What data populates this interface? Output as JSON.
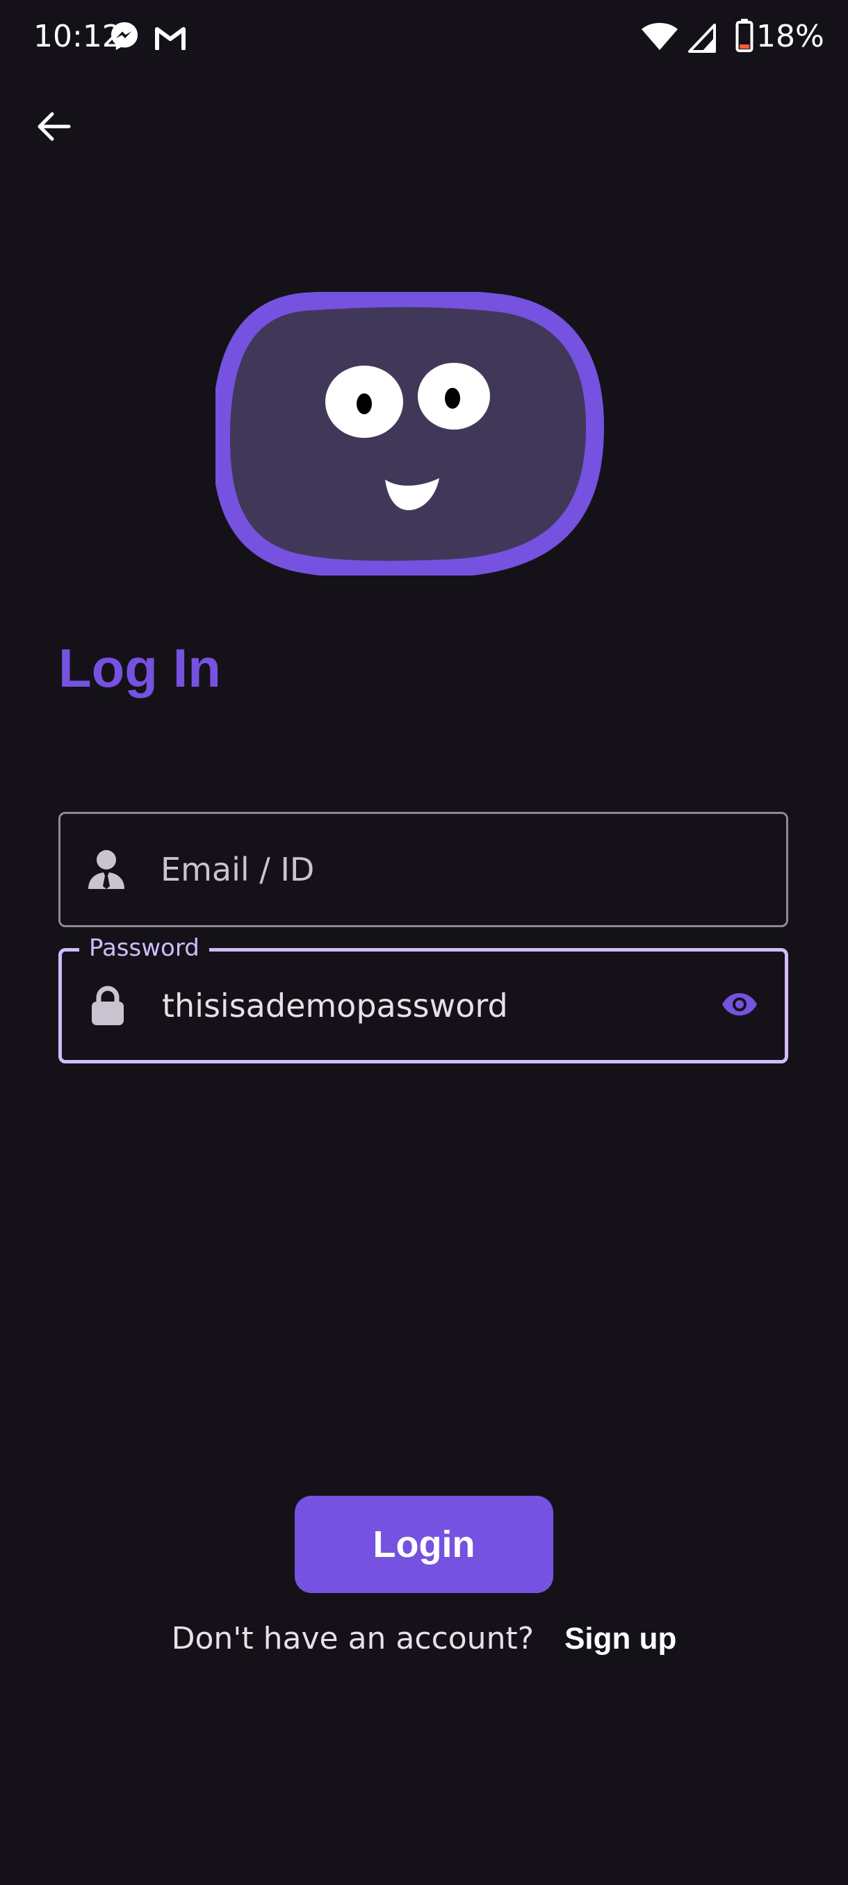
{
  "status_bar": {
    "time": "10:12",
    "battery_percent": "18%",
    "notification_icons": [
      "messenger-icon",
      "gmail-icon"
    ],
    "system_icons": [
      "wifi-icon",
      "cellular-signal-icon",
      "battery-icon"
    ]
  },
  "header": {
    "back_icon": "arrow-left-icon"
  },
  "mascot": {
    "icon": "smiling-blob-mascot",
    "colors": {
      "outline": "#7552e0",
      "fill": "#413859",
      "eyes": "#ffffff",
      "pupils": "#000000"
    }
  },
  "login": {
    "title": "Log In",
    "email": {
      "placeholder": "Email / ID",
      "value": "",
      "icon": "person-icon"
    },
    "password": {
      "label": "Password",
      "value": "thisisademopassword",
      "icon": "lock-icon",
      "toggle_icon": "eye-icon"
    },
    "submit_label": "Login",
    "signup_prompt": "Don't have an account?",
    "signup_link": "Sign up"
  },
  "colors": {
    "background": "#141218",
    "accent": "#7552e0",
    "focus_outline": "#d0bcff"
  }
}
